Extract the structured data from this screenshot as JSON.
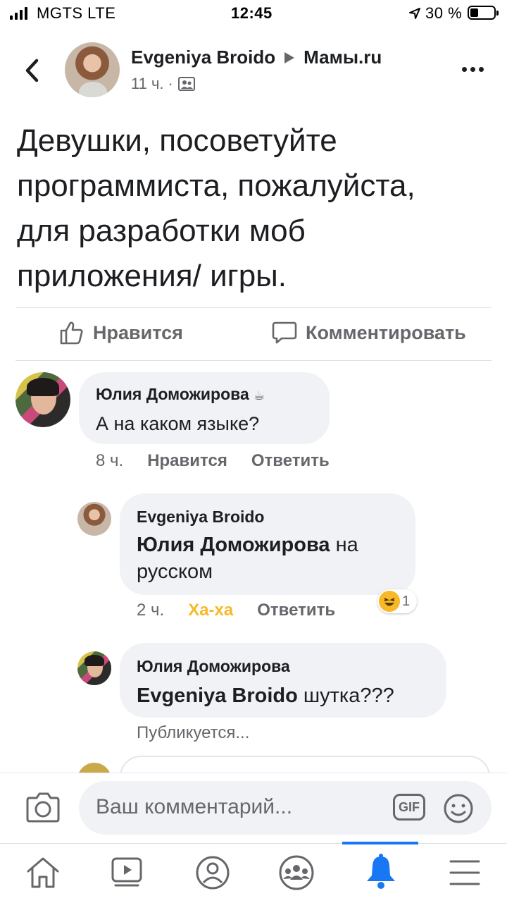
{
  "status_bar": {
    "carrier": "MGTS LTE",
    "time": "12:45",
    "battery": "30 %"
  },
  "post": {
    "author": "Evgeniya Broido",
    "group": "Мамы.ru",
    "time": "11 ч.",
    "dot": "·",
    "text": "Девушки, посоветуйте\nпрограммиста, пожалуйста,\nдля разработки моб\nприложения/ игры."
  },
  "actions": {
    "like": "Нравится",
    "comment": "Комментировать"
  },
  "comments": [
    {
      "author": "Юлия Доможирова",
      "author_badge": "☕",
      "text": "А на каком языке?",
      "time": "8 ч.",
      "like": "Нравится",
      "reply": "Ответить"
    },
    {
      "author": "Evgeniya Broido",
      "mention": "Юлия Доможирова",
      "text_after": " на",
      "text_line2": "русском",
      "time": "2 ч.",
      "reaction": "Ха-ха",
      "reply": "Ответить",
      "reaction_count": "1",
      "reaction_emoji": "😆"
    },
    {
      "author": "Юлия Доможирова",
      "mention": "Evgeniya Broido",
      "text_after": " шутка???",
      "status": "Публикуется..."
    }
  ],
  "composer": {
    "placeholder": "Ваш комментарий...",
    "gif": "GIF"
  },
  "colors": {
    "accent": "#1877f2",
    "haha": "#f7b928",
    "bubble": "#f0f2f5",
    "muted": "#65676b"
  }
}
